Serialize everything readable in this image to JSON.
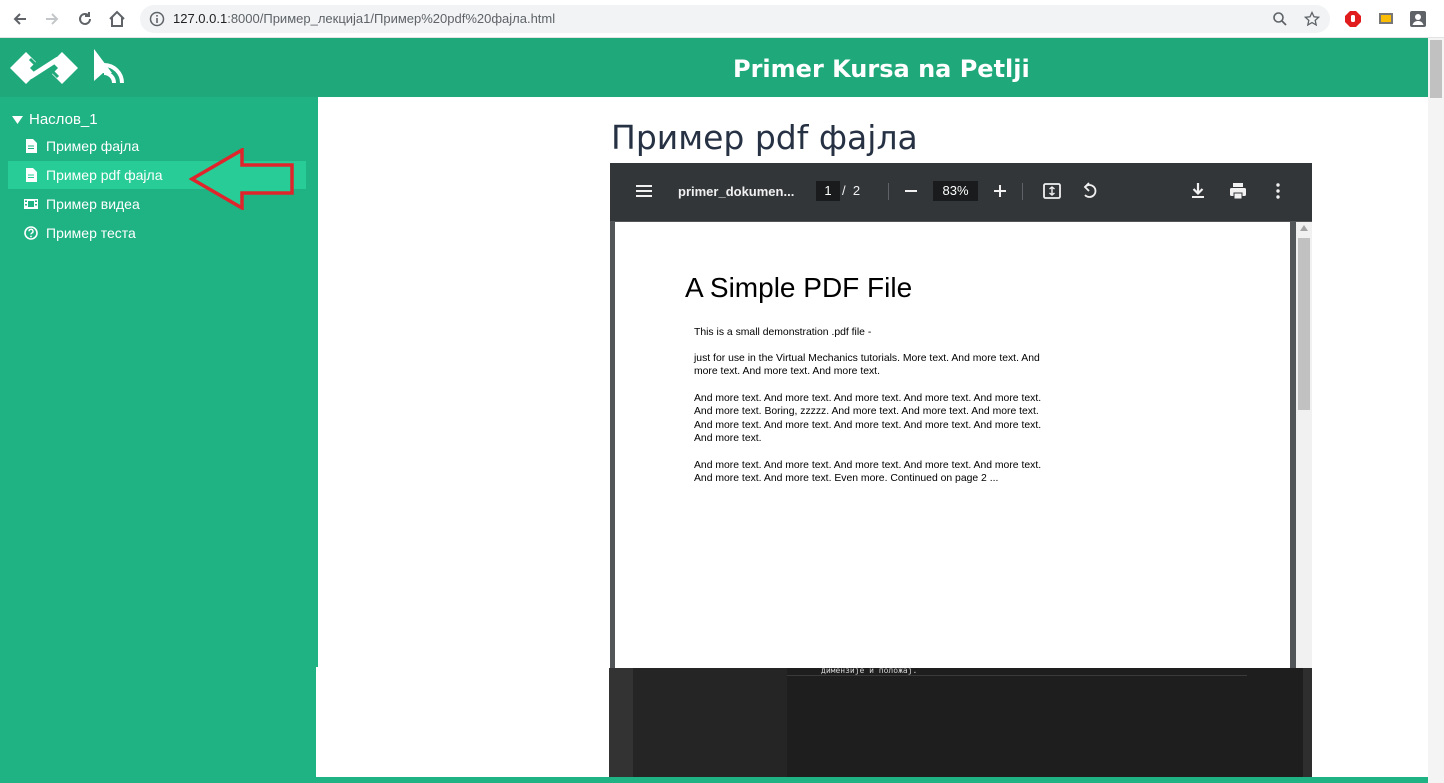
{
  "browser": {
    "url_host": "127.0.0.1",
    "url_rest": ":8000/Пример_лекција1/Пример%20pdf%20фајла.html"
  },
  "header": {
    "title": "Primer Kursa na Petlji"
  },
  "sidebar": {
    "section_title": "Наслов_1",
    "items": [
      {
        "label": "Пример фајла",
        "icon": "file-icon"
      },
      {
        "label": "Пример pdf фајла",
        "icon": "file-icon"
      },
      {
        "label": "Пример видеа",
        "icon": "film-icon"
      },
      {
        "label": "Пример теста",
        "icon": "question-circle-icon"
      }
    ]
  },
  "main": {
    "title": "Пример pdf фајла"
  },
  "pdf_viewer": {
    "file_name": "primer_dokumen...",
    "current_page": "1",
    "page_separator": "/",
    "total_pages": "2",
    "zoom": "83%"
  },
  "document": {
    "heading": "A Simple PDF File",
    "paragraphs": [
      "This is a small demonstration .pdf file -",
      "just for use in the Virtual Mechanics tutorials. More text. And more text. And more text. And more text. And more text.",
      "And more text. And more text. And more text. And more text. And more text. And more text. Boring, zzzzz. And more text. And more text. And more text. And more text. And more text. And more text. And more text. And more text. And more text.",
      "And more text. And more text. And more text. And more text. And more text. And more text. And more text. Even more. Continued on page 2 ..."
    ]
  },
  "editor_snippet": "димензије и положај.",
  "colors": {
    "header_green": "#1fa97a",
    "sidebar_green": "#1fb283",
    "active_item": "#27cc96",
    "annotation_arrow": "#e0242c",
    "pdf_toolbar": "#323639"
  }
}
